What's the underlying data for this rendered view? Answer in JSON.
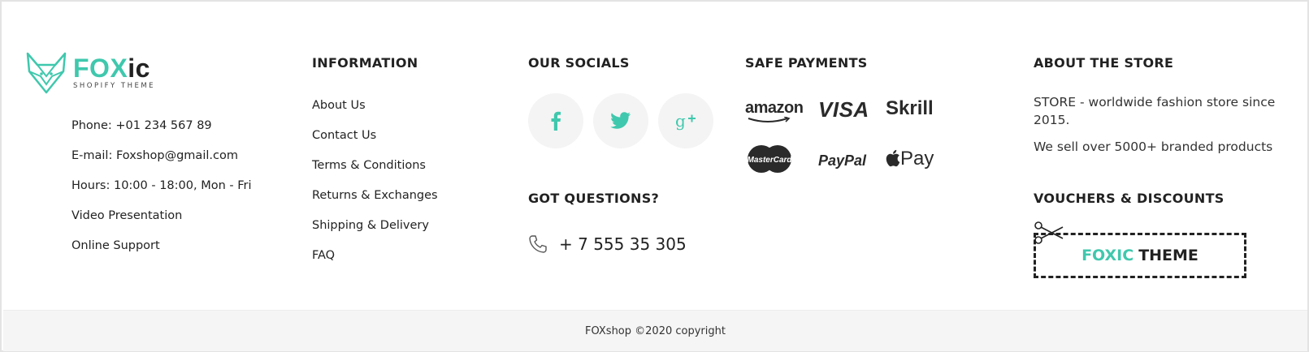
{
  "brand": {
    "logo_fox": "FOX",
    "logo_ic": "ic",
    "tagline": "SHOPIFY THEME",
    "accent_color": "#3fc8ad"
  },
  "contact": {
    "items": [
      "Phone: +01 234 567 89",
      "E-mail: Foxshop@gmail.com",
      "Hours: 10:00 - 18:00, Mon - Fri",
      "Video Presentation",
      "Online Support"
    ]
  },
  "information": {
    "title": "INFORMATION",
    "links": [
      "About Us",
      "Contact Us",
      "Terms & Conditions",
      "Returns & Exchanges",
      "Shipping & Delivery",
      "FAQ"
    ]
  },
  "socials": {
    "title": "OUR SOCIALS",
    "icons": [
      {
        "name": "facebook-icon",
        "glyph": "f"
      },
      {
        "name": "twitter-icon",
        "glyph": "t"
      },
      {
        "name": "google-plus-icon",
        "glyph": "g+"
      }
    ]
  },
  "questions": {
    "title": "GOT QUESTIONS?",
    "phone": "+ 7 555 35 305",
    "icon": "phone-icon"
  },
  "payments": {
    "title": "SAFE PAYMENTS",
    "methods": [
      "amazon",
      "VISA",
      "Skrill",
      "MasterCard",
      "PayPal",
      "Pay"
    ]
  },
  "about": {
    "title": "ABOUT THE STORE",
    "line1": "STORE - worldwide fashion store since 2015.",
    "line2": "We sell over 5000+ branded products"
  },
  "vouchers": {
    "title": "VOUCHERS & DISCOUNTS",
    "code_part1": "FOXIC",
    "code_part2": "THEME",
    "icon": "scissors-icon"
  },
  "footer_bottom": {
    "copyright": "FOXshop ©2020 copyright"
  }
}
